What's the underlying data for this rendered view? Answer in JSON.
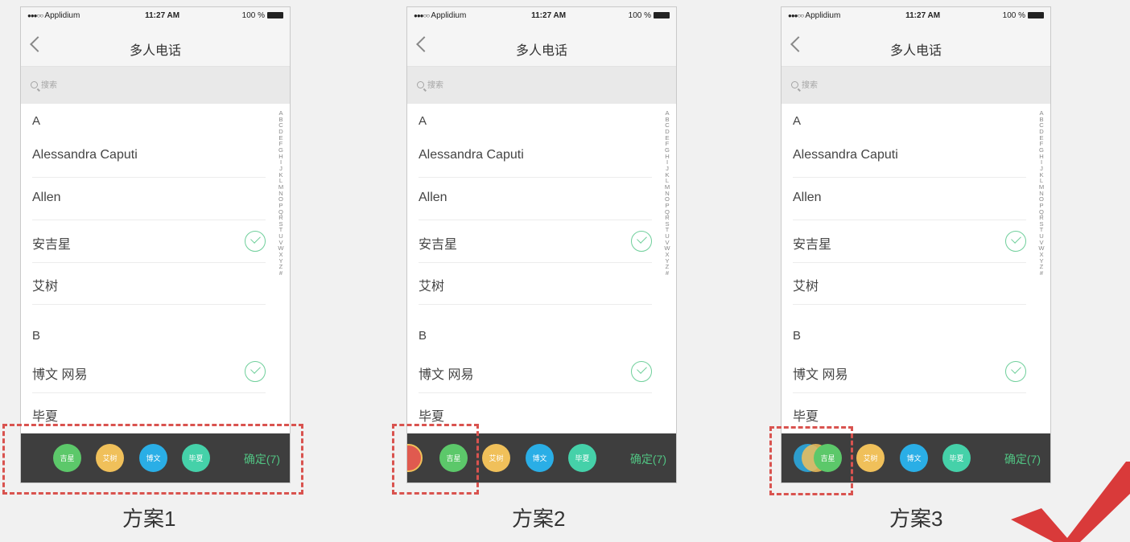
{
  "phones": [
    {
      "status": {
        "signal": "●●●○○",
        "carrier": "Applidium",
        "time": "11:27 AM",
        "battery": "100 %"
      },
      "nav_title": "多人电话",
      "search_placeholder": "搜索",
      "section_a": "A",
      "section_b": "B",
      "contacts": [
        "Alessandra Caputi",
        "Allen",
        "安吉星",
        "艾树",
        "博文 网易",
        "毕夏"
      ],
      "index": [
        "A",
        "B",
        "C",
        "D",
        "E",
        "F",
        "G",
        "H",
        "I",
        "J",
        "K",
        "L",
        "M",
        "N",
        "O",
        "P",
        "Q",
        "R",
        "S",
        "T",
        "U",
        "V",
        "W",
        "X",
        "Y",
        "Z",
        "#"
      ],
      "avatars": [
        "吉星",
        "艾树",
        "博文",
        "毕夏"
      ],
      "confirm": "确定(7)",
      "caption": "方案1"
    },
    {
      "status": {
        "signal": "●●●○○",
        "carrier": "Applidium",
        "time": "11:27 AM",
        "battery": "100 %"
      },
      "nav_title": "多人电话",
      "search_placeholder": "搜索",
      "section_a": "A",
      "section_b": "B",
      "contacts": [
        "Alessandra Caputi",
        "Allen",
        "安吉星",
        "艾树",
        "博文 网易",
        "毕夏"
      ],
      "index": [
        "A",
        "B",
        "C",
        "D",
        "E",
        "F",
        "G",
        "H",
        "I",
        "J",
        "K",
        "L",
        "M",
        "N",
        "O",
        "P",
        "Q",
        "R",
        "S",
        "T",
        "U",
        "V",
        "W",
        "X",
        "Y",
        "Z",
        "#"
      ],
      "avatars": [
        "吉星",
        "艾树",
        "博文",
        "毕夏"
      ],
      "confirm": "确定(7)",
      "caption": "方案2"
    },
    {
      "status": {
        "signal": "●●●○○",
        "carrier": "Applidium",
        "time": "11:27 AM",
        "battery": "100 %"
      },
      "nav_title": "多人电话",
      "search_placeholder": "搜索",
      "section_a": "A",
      "section_b": "B",
      "contacts": [
        "Alessandra Caputi",
        "Allen",
        "安吉星",
        "艾树",
        "博文 网易",
        "毕夏"
      ],
      "index": [
        "A",
        "B",
        "C",
        "D",
        "E",
        "F",
        "G",
        "H",
        "I",
        "J",
        "K",
        "L",
        "M",
        "N",
        "O",
        "P",
        "Q",
        "R",
        "S",
        "T",
        "U",
        "V",
        "W",
        "X",
        "Y",
        "Z",
        "#"
      ],
      "avatars": [
        "吉星",
        "艾树",
        "博文",
        "毕夏"
      ],
      "confirm": "确定(7)",
      "caption": "方案3"
    }
  ],
  "colors": {
    "avatar_green": "#5cc86a",
    "avatar_yellow": "#f0c05a",
    "avatar_blue": "#2aaee6",
    "avatar_teal": "#45d1a9",
    "avatar_red": "#e05a4f",
    "confirm_green": "#51c483",
    "bar_dark": "#3e3e3e",
    "dash_red": "#d9534f"
  },
  "icons": [
    "back-icon",
    "search-icon",
    "check-icon",
    "big-checkmark-icon"
  ]
}
